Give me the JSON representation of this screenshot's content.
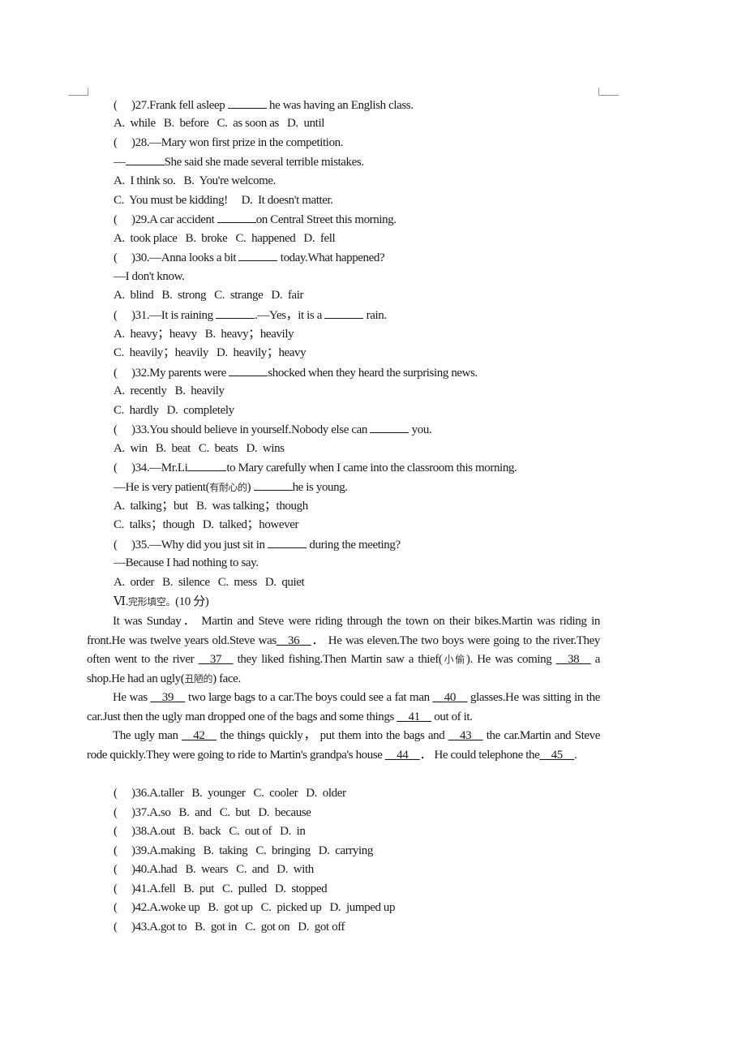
{
  "questions_mc": [
    {
      "num": "27",
      "stem_before": ".Frank fell asleep ",
      "stem_after": " he was having an English class.",
      "options_lines": [
        "A.  while   B.  before   C.  as soon as   D.  until"
      ]
    },
    {
      "num": "28",
      "stem_before": ".—Mary won first prize in the competition.",
      "stem_after": "",
      "reply_before": "—",
      "reply_after": "She said she made several terrible mistakes.",
      "options_lines": [
        "A.  I think so.   B.  You're welcome.",
        "C.  You must be kidding!     D.  It doesn't matter."
      ]
    },
    {
      "num": "29",
      "stem_before": ".A car accident ",
      "stem_after": "on Central Street this morning.",
      "options_lines": [
        "A.  took place   B.  broke   C.  happened   D.  fell"
      ]
    },
    {
      "num": "30",
      "stem_before": ".—Anna looks a bit ",
      "stem_after": " today.What happened?",
      "reply": "—I don't know.",
      "options_lines": [
        "A.  blind   B.  strong   C.  strange   D.  fair"
      ]
    },
    {
      "num": "31",
      "stem_before": ".—It is raining ",
      "stem_mid": ".—Yes，it is a ",
      "stem_after": " rain.",
      "options_lines": [
        "A.  heavy；heavy   B.  heavy；heavily",
        "C.  heavily；heavily   D.  heavily；heavy"
      ]
    },
    {
      "num": "32",
      "stem_before": ".My parents were ",
      "stem_after": "shocked when they heard the surprising news.",
      "options_lines": [
        "A.  recently   B.  heavily",
        "C.  hardly   D.  completely"
      ]
    },
    {
      "num": "33",
      "stem_before": ".You should believe in yourself.Nobody else can ",
      "stem_after": " you.",
      "options_lines": [
        "A.  win   B.  beat   C.  beats   D.  wins"
      ]
    },
    {
      "num": "34",
      "stem_before": ".—Mr.Li",
      "stem_after": "to Mary carefully when I came into the classroom this morning.",
      "reply_before": "—He is very patient(",
      "reply_cn": "有耐心的",
      "reply_mid": ") ",
      "reply_after": "he is young.",
      "options_lines": [
        "A.  talking；but   B.  was talking；though",
        "C.  talks；though   D.  talked；however"
      ]
    },
    {
      "num": "35",
      "stem_before": ".—Why did you just sit in ",
      "stem_after": " during the meeting?",
      "reply": "—Because I had nothing to say.",
      "options_lines": [
        "A.  order   B.  silence   C.  mess   D.  quiet"
      ]
    }
  ],
  "section": {
    "roman": "Ⅵ.",
    "title_cn": "完形填空。",
    "points": "(10 分)"
  },
  "passage": {
    "p1": [
      "It was Sunday． Martin and Steve were riding through the town on their bikes.Martin was riding in front.He was twelve years old.Steve was",
      "__36__",
      "． He was eleven.The two boys were going to the river.They often went to the river ",
      "__37__",
      " they liked fishing.Then Martin saw a thief(",
      "小偷",
      ").  He was coming ",
      "__38__",
      " a shop.He had an ugly(",
      "丑陋的",
      ") face."
    ],
    "p2": [
      "He was ",
      "__39__",
      " two large bags to a car.The boys could see a fat man ",
      "__40__",
      " glasses.He was sitting in the car.Just then the ugly man dropped one of the bags and some things ",
      "__41__",
      " out of it."
    ],
    "p3": [
      "The ugly man ",
      "__42__",
      " the things quickly， put them into the bags and ",
      "__43__",
      " the car.Martin and Steve rode quickly.They were going to ride to Martin's grandpa's house ",
      "__44__",
      "． He could telephone the",
      "__45__",
      "."
    ]
  },
  "cloze_options": [
    {
      "num": "36",
      "text": ".A.taller   B.  younger   C.  cooler   D.  older"
    },
    {
      "num": "37",
      "text": ".A.so   B.  and   C.  but   D.  because"
    },
    {
      "num": "38",
      "text": ".A.out   B.  back   C.  out of   D.  in"
    },
    {
      "num": "39",
      "text": ".A.making   B.  taking   C.  bringing   D.  carrying"
    },
    {
      "num": "40",
      "text": ".A.had   B.  wears   C.  and   D.  with"
    },
    {
      "num": "41",
      "text": ".A.fell   B.  put   C.  pulled   D.  stopped"
    },
    {
      "num": "42",
      "text": ".A.woke up   B.  got up   C.  picked up   D.  jumped up"
    },
    {
      "num": "43",
      "text": ".A.got to   B.  got in   C.  got on   D.  got off"
    }
  ],
  "paren_open": "(",
  "paren_close": ")"
}
